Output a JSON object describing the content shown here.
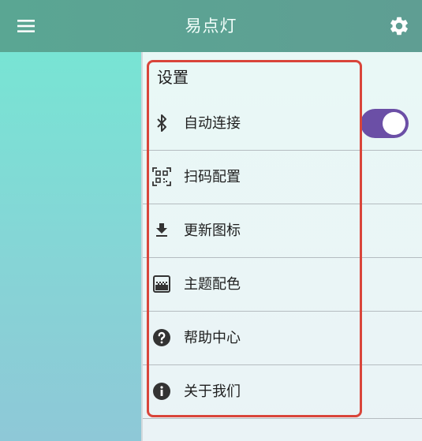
{
  "appbar": {
    "title": "易点灯",
    "menu_icon": "hamburger-menu-icon",
    "settings_icon": "gear-icon",
    "color": "#5aa693"
  },
  "drawer": {
    "title": "设置",
    "items": [
      {
        "label": "自动连接",
        "icon": "bluetooth-icon"
      },
      {
        "label": "扫码配置",
        "icon": "qr-scan-icon"
      },
      {
        "label": "更新图标",
        "icon": "download-icon"
      },
      {
        "label": "主题配色",
        "icon": "gradient-icon"
      },
      {
        "label": "帮助中心",
        "icon": "help-circle-icon"
      },
      {
        "label": "关于我们",
        "icon": "info-circle-icon"
      }
    ],
    "auto_connect_toggle": {
      "on": true,
      "color": "#6b4fa6"
    },
    "highlight_color": "#d9453a"
  }
}
